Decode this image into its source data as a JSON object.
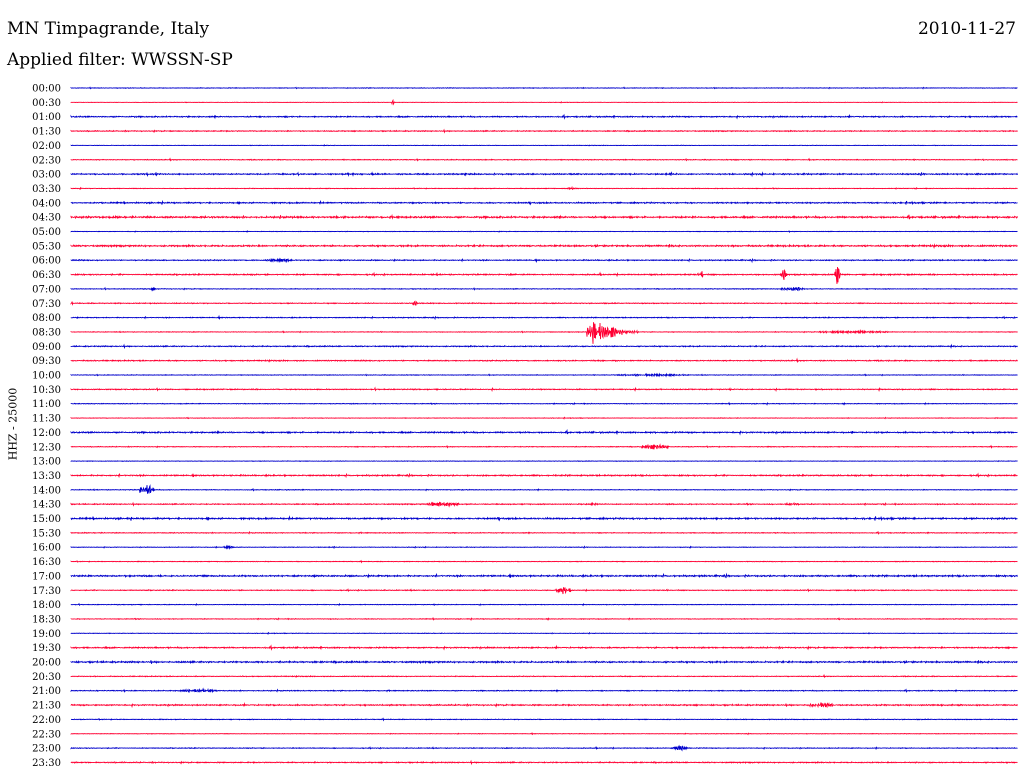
{
  "header": {
    "station": "MN Timpagrande, Italy",
    "date": "2010-11-27",
    "filter_label": "Applied filter: WWSSN-SP"
  },
  "channel_label": "HHZ - 25000",
  "colors": {
    "trace_a": "#0000cc",
    "trace_b": "#ff0033",
    "background": "#ffffff",
    "text": "#000000"
  },
  "chart_data": {
    "type": "line",
    "subtype": "helicorder",
    "row_interval_minutes": 30,
    "y_ticks": [
      "00:00",
      "00:30",
      "01:00",
      "01:30",
      "02:00",
      "02:30",
      "03:00",
      "03:30",
      "04:00",
      "04:30",
      "05:00",
      "05:30",
      "06:00",
      "06:30",
      "07:00",
      "07:30",
      "08:00",
      "08:30",
      "09:00",
      "09:30",
      "10:00",
      "10:30",
      "11:00",
      "11:30",
      "12:00",
      "12:30",
      "13:00",
      "13:30",
      "14:00",
      "14:30",
      "15:00",
      "15:30",
      "16:00",
      "16:30",
      "17:00",
      "17:30",
      "18:00",
      "18:30",
      "19:00",
      "19:30",
      "20:00",
      "20:30",
      "21:00",
      "21:30",
      "22:00",
      "22:30",
      "23:00",
      "23:30"
    ],
    "x_range_minutes": [
      0,
      30
    ],
    "alternating_colors": [
      "#0000cc",
      "#ff0033"
    ],
    "row_noise": [
      0.35,
      0.2,
      0.7,
      0.55,
      0.25,
      0.45,
      0.75,
      0.35,
      0.75,
      1.0,
      0.3,
      0.9,
      0.6,
      0.7,
      0.4,
      0.5,
      0.5,
      0.35,
      0.6,
      0.6,
      0.35,
      0.55,
      0.4,
      0.3,
      0.8,
      0.4,
      0.3,
      0.75,
      0.4,
      0.55,
      0.9,
      0.45,
      0.35,
      0.35,
      0.9,
      0.5,
      0.35,
      0.4,
      0.3,
      0.75,
      0.9,
      0.45,
      0.5,
      0.75,
      0.4,
      0.3,
      0.45,
      0.6
    ],
    "events": [
      {
        "row": 1,
        "minute": 10.2,
        "amp": 2.5,
        "dur": 0.05,
        "kind": "spike"
      },
      {
        "row": 7,
        "minute": 15.9,
        "amp": 1.5,
        "dur": 0.3,
        "kind": "burst"
      },
      {
        "row": 12,
        "minute": 6.6,
        "amp": 3,
        "dur": 0.8,
        "kind": "burst"
      },
      {
        "row": 13,
        "minute": 20.0,
        "amp": 4,
        "dur": 0.05,
        "kind": "spike"
      },
      {
        "row": 13,
        "minute": 22.6,
        "amp": 6,
        "dur": 0.1,
        "kind": "spike"
      },
      {
        "row": 13,
        "minute": 24.3,
        "amp": 10,
        "dur": 0.1,
        "kind": "spike"
      },
      {
        "row": 14,
        "minute": 2.6,
        "amp": 1.5,
        "dur": 0.1,
        "kind": "spike"
      },
      {
        "row": 14,
        "minute": 22.9,
        "amp": 2,
        "dur": 0.8,
        "kind": "burst"
      },
      {
        "row": 15,
        "minute": 10.9,
        "amp": 2.5,
        "dur": 0.1,
        "kind": "spike"
      },
      {
        "row": 17,
        "minute": 16.4,
        "amp": 17,
        "dur": 1.6,
        "kind": "quake"
      },
      {
        "row": 17,
        "minute": 24.8,
        "amp": 1.5,
        "dur": 2.2,
        "kind": "burst"
      },
      {
        "row": 20,
        "minute": 18.4,
        "amp": 1.2,
        "dur": 2.4,
        "kind": "burst"
      },
      {
        "row": 25,
        "minute": 18.5,
        "amp": 3,
        "dur": 0.9,
        "kind": "burst"
      },
      {
        "row": 28,
        "minute": 2.4,
        "amp": 6,
        "dur": 0.5,
        "kind": "burst"
      },
      {
        "row": 29,
        "minute": 11.7,
        "amp": 2.5,
        "dur": 1.2,
        "kind": "burst"
      },
      {
        "row": 29,
        "minute": 16.5,
        "amp": 1.5,
        "dur": 0.5,
        "kind": "burst"
      },
      {
        "row": 29,
        "minute": 22.9,
        "amp": 1.5,
        "dur": 0.5,
        "kind": "burst"
      },
      {
        "row": 32,
        "minute": 5.0,
        "amp": 1.5,
        "dur": 0.3,
        "kind": "burst"
      },
      {
        "row": 35,
        "minute": 15.6,
        "amp": 4,
        "dur": 0.5,
        "kind": "burst"
      },
      {
        "row": 42,
        "minute": 4.0,
        "amp": 2,
        "dur": 1.2,
        "kind": "burst"
      },
      {
        "row": 43,
        "minute": 23.8,
        "amp": 2.5,
        "dur": 0.9,
        "kind": "burst"
      },
      {
        "row": 46,
        "minute": 19.3,
        "amp": 2,
        "dur": 0.3,
        "kind": "spike"
      }
    ]
  }
}
